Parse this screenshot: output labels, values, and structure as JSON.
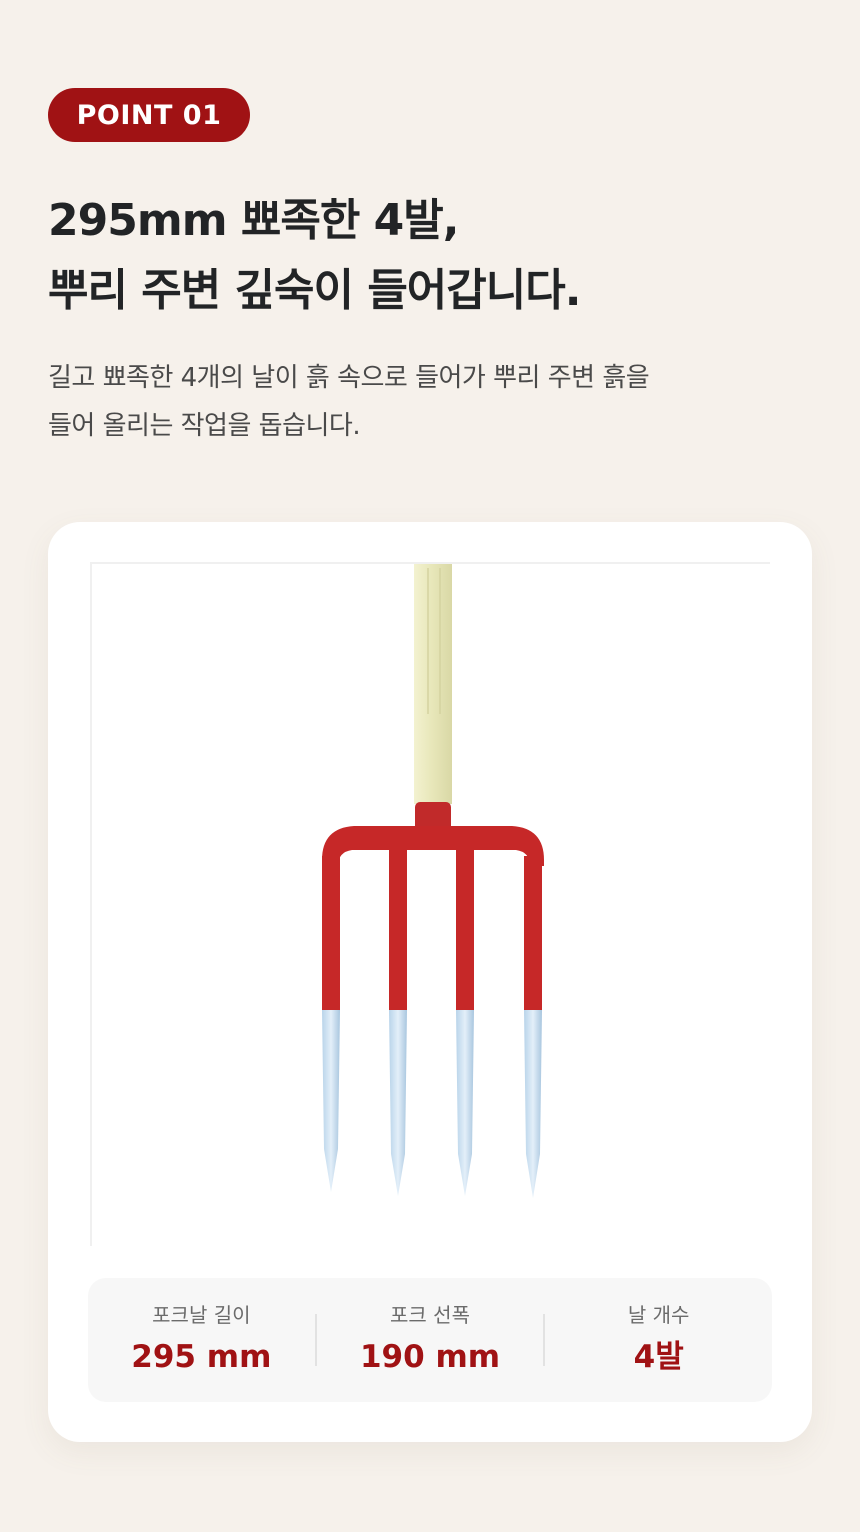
{
  "badge": {
    "label": "POINT 01"
  },
  "headline": {
    "line1": "295mm 뾰족한 4발,",
    "line2": "뿌리 주변 깊숙이 들어갑니다."
  },
  "description": {
    "line1": "길고 뾰족한 4개의 날이 흙 속으로 들어가 뿌리 주변 흙을",
    "line2": "들어 올리는 작업을 돕습니다."
  },
  "specs": [
    {
      "label": "포크날 길이",
      "value": "295 mm"
    },
    {
      "label": "포크 선폭",
      "value": "190 mm"
    },
    {
      "label": "날 개수",
      "value": "4발"
    }
  ],
  "colors": {
    "accent": "#a01214",
    "background": "#f6f1eb",
    "card": "#ffffff",
    "fork_red": "#c62828",
    "handle": "#ecebc2",
    "steel": "#cfe3f3"
  },
  "image": {
    "subject": "fork-icon"
  }
}
